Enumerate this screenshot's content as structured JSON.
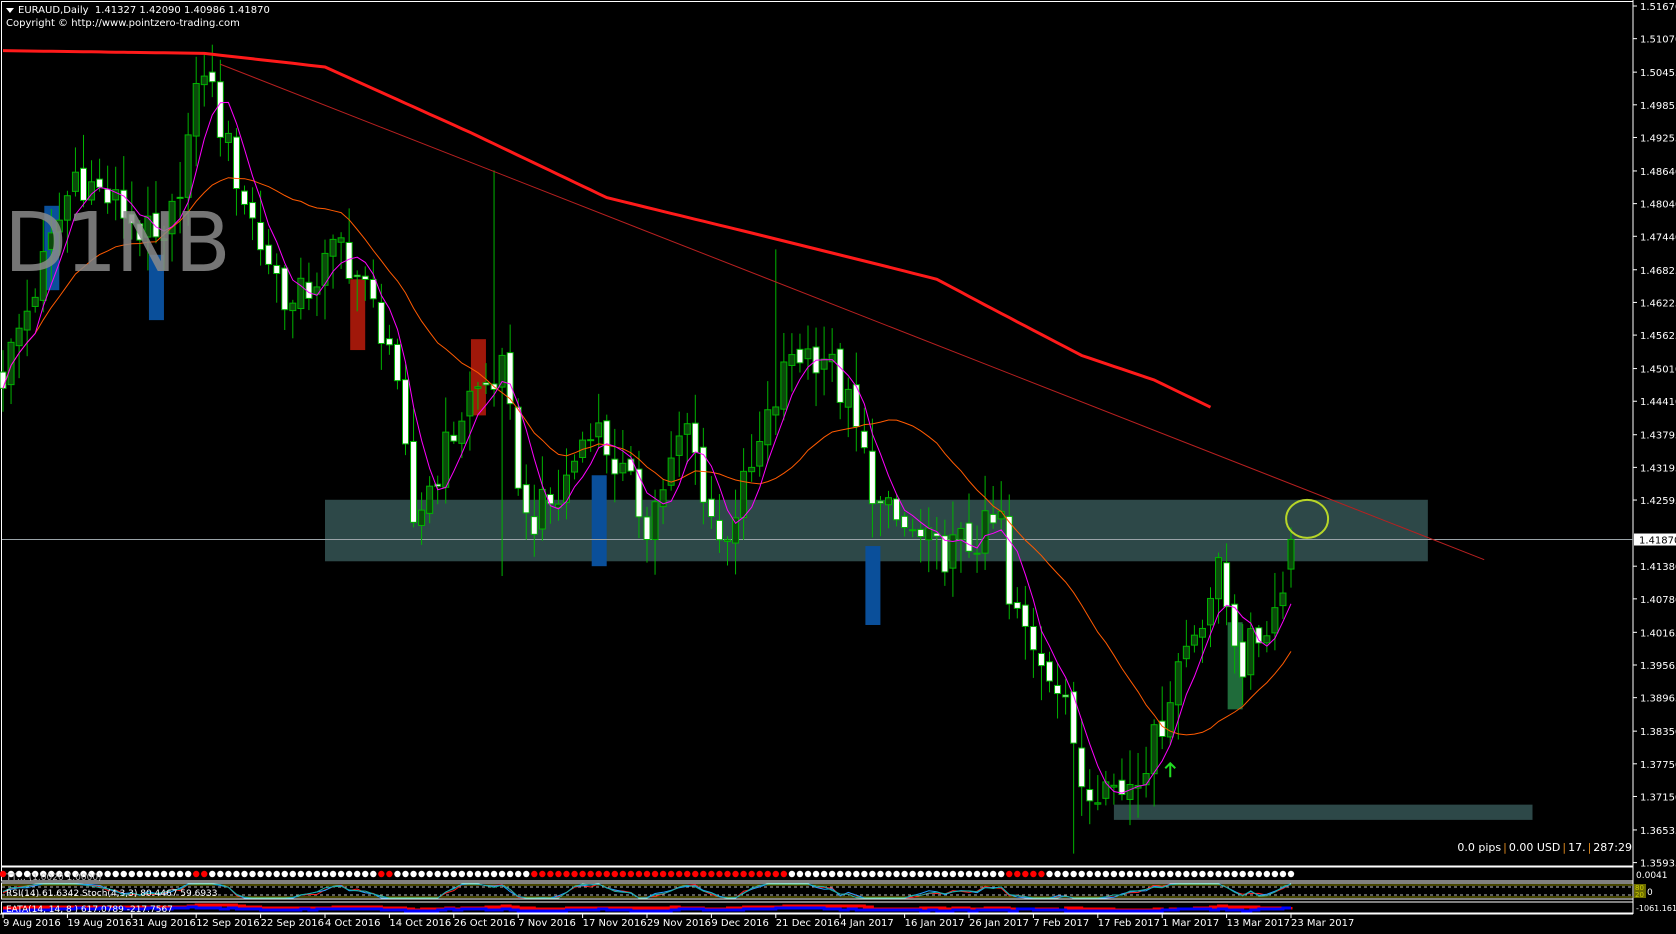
{
  "header": {
    "symbol_timeframe": "EURAUD,Daily",
    "ohlc": "1.41327 1.42090 1.40986 1.41870",
    "copyright": "Copyright © http://www.pointzero-trading.com"
  },
  "watermark": "D1NB",
  "status": {
    "pips": "0.0 pips",
    "usd": "0.00 USD",
    "count": "17.",
    "timer": "287:29",
    "sep": "|"
  },
  "current_price_label": "1.41870",
  "indicators": {
    "dots_label": "TT… (1.0020 1.0000)",
    "rsi_label": "RSI(14) 61.6342  Stoch(4,3,3) 80.4467 59.6933",
    "eata_label": "EATA(14, 14, 8 ) 617.0789 -217.7567",
    "rsi_levels": [
      "80",
      "20"
    ],
    "dots_axis": "0.0041",
    "rsi_axis": "0",
    "eata_axis": "-1061.161"
  },
  "colors": {
    "bull_body": "#0b4a0b",
    "candle_line": "#00b400",
    "bear_body": "#ffffff",
    "ma200": "#ff1a1a",
    "ma_fast": "#ff00ff",
    "ma_slow": "#ff5a00",
    "zone": "#2f4c4c",
    "trendline": "#b82020",
    "circle": "#b8d628"
  },
  "chart_data": {
    "type": "candlestick",
    "symbol": "EURAUD",
    "timeframe": "Daily",
    "bars": 161,
    "close_keypoints": [
      [
        0,
        1.449
      ],
      [
        6,
        1.473
      ],
      [
        9,
        1.486
      ],
      [
        15,
        1.479
      ],
      [
        20,
        1.471
      ],
      [
        25,
        1.506
      ],
      [
        28,
        1.49
      ],
      [
        32,
        1.473
      ],
      [
        36,
        1.461
      ],
      [
        42,
        1.473
      ],
      [
        48,
        1.455
      ],
      [
        51,
        1.422
      ],
      [
        58,
        1.445
      ],
      [
        62,
        1.449
      ],
      [
        65,
        1.422
      ],
      [
        69,
        1.426
      ],
      [
        73,
        1.441
      ],
      [
        80,
        1.422
      ],
      [
        85,
        1.439
      ],
      [
        89,
        1.418
      ],
      [
        93,
        1.431
      ],
      [
        98,
        1.453
      ],
      [
        102,
        1.453
      ],
      [
        105,
        1.443
      ],
      [
        109,
        1.424
      ],
      [
        116,
        1.416
      ],
      [
        120,
        1.418
      ],
      [
        124,
        1.422
      ],
      [
        125,
        1.406
      ],
      [
        130,
        1.396
      ],
      [
        133,
        1.382
      ],
      [
        134,
        1.375
      ],
      [
        139,
        1.373
      ],
      [
        143,
        1.381
      ],
      [
        146,
        1.396
      ],
      [
        151,
        1.412
      ],
      [
        154,
        1.396
      ],
      [
        158,
        1.406
      ],
      [
        160,
        1.4187
      ]
    ],
    "ma200_keypoints": [
      [
        0,
        1.5085
      ],
      [
        25,
        1.508
      ],
      [
        40,
        1.5055
      ],
      [
        58,
        1.4935
      ],
      [
        75,
        1.4815
      ],
      [
        93,
        1.475
      ],
      [
        108,
        1.4695
      ],
      [
        116,
        1.4665
      ],
      [
        123,
        1.461
      ],
      [
        134,
        1.4525
      ],
      [
        143,
        1.448
      ],
      [
        150,
        1.443
      ]
    ],
    "trendline": [
      [
        27,
        1.506
      ],
      [
        184,
        1.415
      ]
    ],
    "horizontal_line": 1.4187,
    "zones": [
      {
        "from_bar": 40,
        "to_bar": 177,
        "top": 1.426,
        "bottom": 1.4147
      },
      {
        "from_bar": 138,
        "to_bar": 190,
        "top": 1.37,
        "bottom": 1.3672
      }
    ],
    "circle": {
      "bar": 162,
      "price": 1.4225
    },
    "up_arrow": {
      "bar": 145,
      "price": 1.3765
    },
    "highlight_bars": [
      {
        "bar": 6,
        "top": 1.48,
        "bottom": 1.4645,
        "color": "#0a4f9a"
      },
      {
        "bar": 19,
        "top": 1.471,
        "bottom": 1.459,
        "color": "#0a4f9a"
      },
      {
        "bar": 44,
        "top": 1.4665,
        "bottom": 1.4535,
        "color": "#a0180a"
      },
      {
        "bar": 59,
        "top": 1.4555,
        "bottom": 1.4415,
        "color": "#a0180a"
      },
      {
        "bar": 74,
        "top": 1.4305,
        "bottom": 1.4138,
        "color": "#0a4f9a"
      },
      {
        "bar": 108,
        "top": 1.4175,
        "bottom": 1.403,
        "color": "#0a4f9a"
      },
      {
        "bar": 153,
        "top": 1.4035,
        "bottom": 1.3875,
        "color": "#1f6b3a"
      }
    ],
    "y_ticks": [
      "1.51670",
      "1.51070",
      "1.50455",
      "1.49855",
      "1.49255",
      "1.48640",
      "1.48040",
      "1.47440",
      "1.46825",
      "1.46225",
      "1.45625",
      "1.45010",
      "1.44410",
      "1.43795",
      "1.43195",
      "1.42595",
      "1.41380",
      "1.40780",
      "1.40165",
      "1.39565",
      "1.38965",
      "1.38350",
      "1.37750",
      "1.37150",
      "1.36535",
      "1.35935"
    ],
    "ylim": [
      1.35935,
      1.5167
    ],
    "x_ticks": [
      "9 Aug 2016",
      "19 Aug 2016",
      "31 Aug 2016",
      "12 Sep 2016",
      "22 Sep 2016",
      "4 Oct 2016",
      "14 Oct 2016",
      "26 Oct 2016",
      "7 Nov 2016",
      "17 Nov 2016",
      "29 Nov 2016",
      "9 Dec 2016",
      "21 Dec 2016",
      "4 Jan 2017",
      "16 Jan 2017",
      "26 Jan 2017",
      "7 Feb 2017",
      "17 Feb 2017",
      "1 Mar 2017",
      "13 Mar 2017",
      "23 Mar 2017"
    ],
    "x_tick_every_bars": 8,
    "red_dot_ranges": [
      [
        0,
        0
      ],
      [
        24,
        25
      ],
      [
        47,
        48
      ],
      [
        66,
        97
      ],
      [
        125,
        129
      ]
    ]
  }
}
